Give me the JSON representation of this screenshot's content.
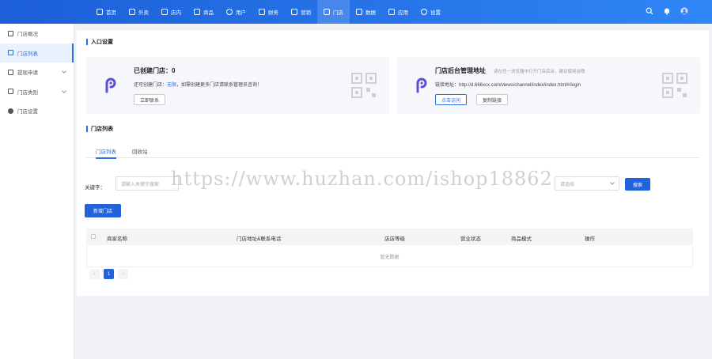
{
  "nav": {
    "items": [
      {
        "label": "首页",
        "icon": "home-icon"
      },
      {
        "label": "外卖",
        "icon": "takeout-icon"
      },
      {
        "label": "店内",
        "icon": "store-icon"
      },
      {
        "label": "商品",
        "icon": "goods-icon"
      },
      {
        "label": "用户",
        "icon": "user-icon"
      },
      {
        "label": "财务",
        "icon": "finance-icon"
      },
      {
        "label": "营销",
        "icon": "gift-icon"
      },
      {
        "label": "门店",
        "icon": "shop-icon",
        "active": true
      },
      {
        "label": "数据",
        "icon": "data-icon"
      },
      {
        "label": "应用",
        "icon": "app-icon"
      },
      {
        "label": "设置",
        "icon": "settings-icon"
      }
    ]
  },
  "sidebar": {
    "items": [
      {
        "label": "门店概况"
      },
      {
        "label": "门店列表",
        "active": true
      },
      {
        "label": "提现申请"
      },
      {
        "label": "门店类别"
      },
      {
        "label": "门店设置"
      }
    ]
  },
  "entry": {
    "title": "入口设置",
    "card1": {
      "title": "已创建门店：0",
      "text_prefix": "还可创建门店：",
      "text_blue": "无限",
      "text_suffix": "，如需创建更多门店请联系管理员咨询！",
      "button": "立即联系"
    },
    "card2": {
      "title": "门店后台管理地址",
      "subtitle": "请在任一浏览器中打开门店后台，建议使用谷歌",
      "text": "链接地址：http://d.666xcx.com/views/channel/index/index.html#/login",
      "button1": "点击访问",
      "button2": "复制链接"
    }
  },
  "list": {
    "title": "门店列表",
    "tabs": [
      "门店列表",
      "回收站"
    ]
  },
  "filters": {
    "keyword_label": "关键字：",
    "keyword_placeholder": "请输入关键字搜索",
    "select_placeholder": "请选择",
    "search_button": "搜索"
  },
  "add_button": "新增门店",
  "table": {
    "headers": [
      "商家名称",
      "门店地址&联系电话",
      "店店等级",
      "营业状态",
      "商品模式",
      "操作"
    ],
    "empty": "暂无数据"
  },
  "pagination": {
    "prev": "‹",
    "page": "1",
    "next": "›"
  },
  "watermark": "https://www.huzhan.com/ishop18862"
}
